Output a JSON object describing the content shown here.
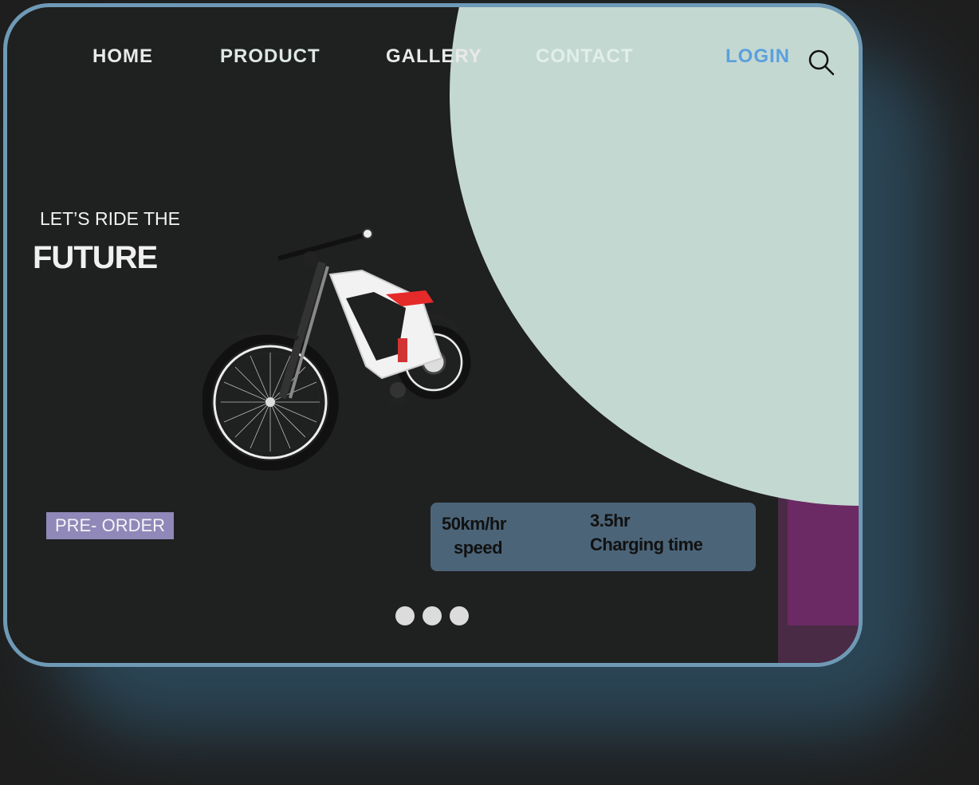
{
  "nav": {
    "home": "HOME",
    "product": "PRODUCT",
    "gallery": "GALLERY",
    "contact": "CONTACT",
    "login": "LOGIN"
  },
  "hero": {
    "tagline": "LET’S RIDE THE",
    "headline": "FUTURE",
    "preorder_label": "PRE- ORDER"
  },
  "stats": [
    {
      "value": "50km/hr",
      "label": "speed"
    },
    {
      "value": "3.5hr",
      "label": "Charging time"
    }
  ],
  "carousel": {
    "dot_count": 3
  },
  "icons": {
    "search": "search-icon",
    "bike": "bike-image"
  },
  "colors": {
    "background": "#1e1e1e",
    "card": "#1f2020",
    "border": "#6e9ab6",
    "mint": "#c4d8d2",
    "pink": "#cdb8d0",
    "magenta": "#6b2a63",
    "preorder": "#8f88b8",
    "stats_panel": "#4b6478",
    "login": "#5aa0dc"
  }
}
